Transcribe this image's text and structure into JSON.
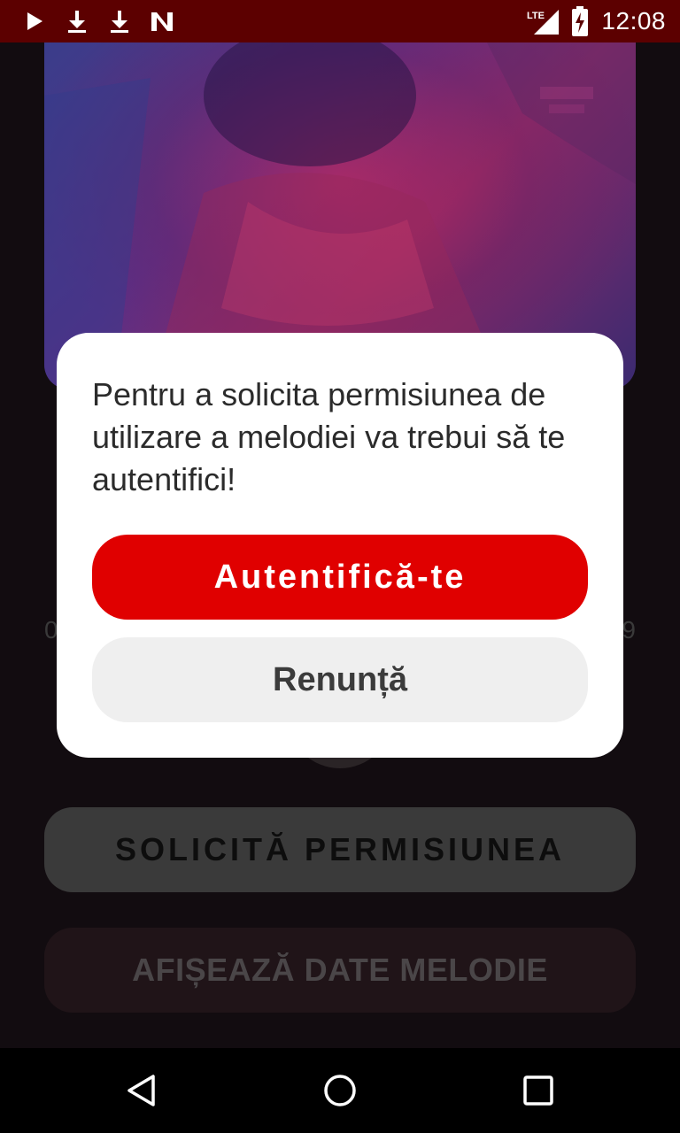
{
  "status_bar": {
    "time": "12:08",
    "network": "LTE",
    "icons_left": [
      "play-icon",
      "download-icon",
      "download-icon",
      "n-app-icon"
    ],
    "icons_right": [
      "lte-signal-icon",
      "battery-icon"
    ]
  },
  "player": {
    "time_left": "0",
    "time_right": "9",
    "request_button": "SOLICITĂ PERMISIUNEA",
    "show_data_button": "AFIȘEAZĂ DATE MELODIE"
  },
  "dialog": {
    "message": "Pentru a solicita permisiunea de utilizare a melodiei va trebui să te autentifici!",
    "login_button": "Autentifică-te",
    "cancel_button": "Renunță"
  },
  "nav_bar": {
    "icons": [
      "back-icon",
      "home-icon",
      "recents-icon"
    ]
  },
  "colors": {
    "status_bar": "#5c0000",
    "accent": "#e00000",
    "dialog_bg": "#ffffff",
    "cancel_bg": "#efefef"
  }
}
